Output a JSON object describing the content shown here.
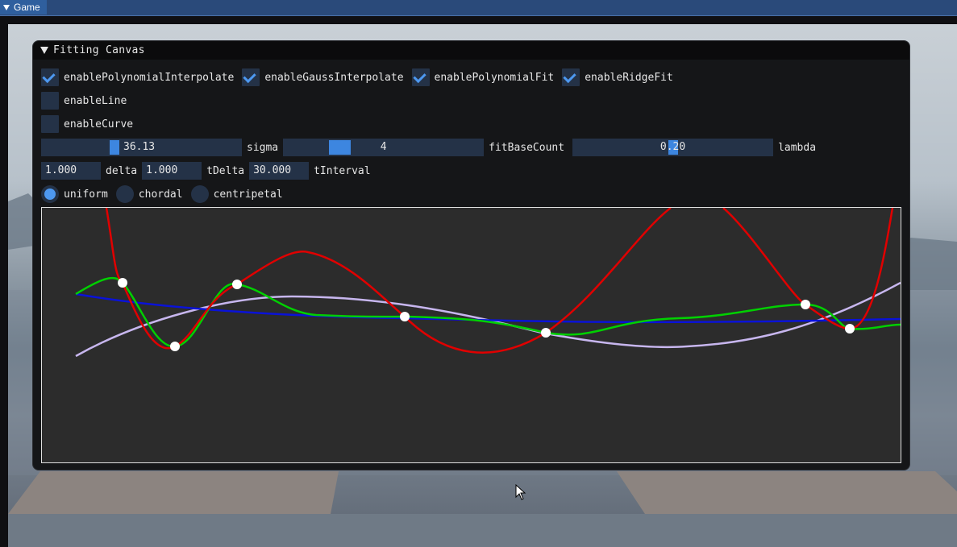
{
  "tab": {
    "label": "Game"
  },
  "window": {
    "title": "Fitting Canvas",
    "checkboxes": [
      {
        "label": "enablePolynomialInterpolate",
        "checked": true
      },
      {
        "label": "enableGaussInterpolate",
        "checked": true
      },
      {
        "label": "enablePolynomialFit",
        "checked": true
      },
      {
        "label": "enableRidgeFit",
        "checked": true
      },
      {
        "label": "enableLine",
        "checked": false
      },
      {
        "label": "enableCurve",
        "checked": false
      }
    ],
    "sliders": [
      {
        "value": "36.13",
        "label": "sigma",
        "fraction": 0.36
      },
      {
        "value": "4",
        "label": "fitBaseCount",
        "fraction": 0.3
      },
      {
        "value": "0.20",
        "label": "lambda",
        "fraction": 0.5
      }
    ],
    "inputs": [
      {
        "value": "1.000",
        "label": "delta"
      },
      {
        "value": "1.000",
        "label": "tDelta"
      },
      {
        "value": "30.000",
        "label": "tInterval"
      }
    ],
    "radios": [
      {
        "label": "uniform",
        "selected": true
      },
      {
        "label": "chordal",
        "selected": false
      },
      {
        "label": "centripetal",
        "selected": false
      }
    ]
  },
  "curve_colors": {
    "polynomial_interpolate": "#e00000",
    "gauss_interpolate": "#00d000",
    "polynomial_fit": "#0a12d8",
    "ridge_fit": "#c7b6ee"
  },
  "accent": "#4d98f0"
}
